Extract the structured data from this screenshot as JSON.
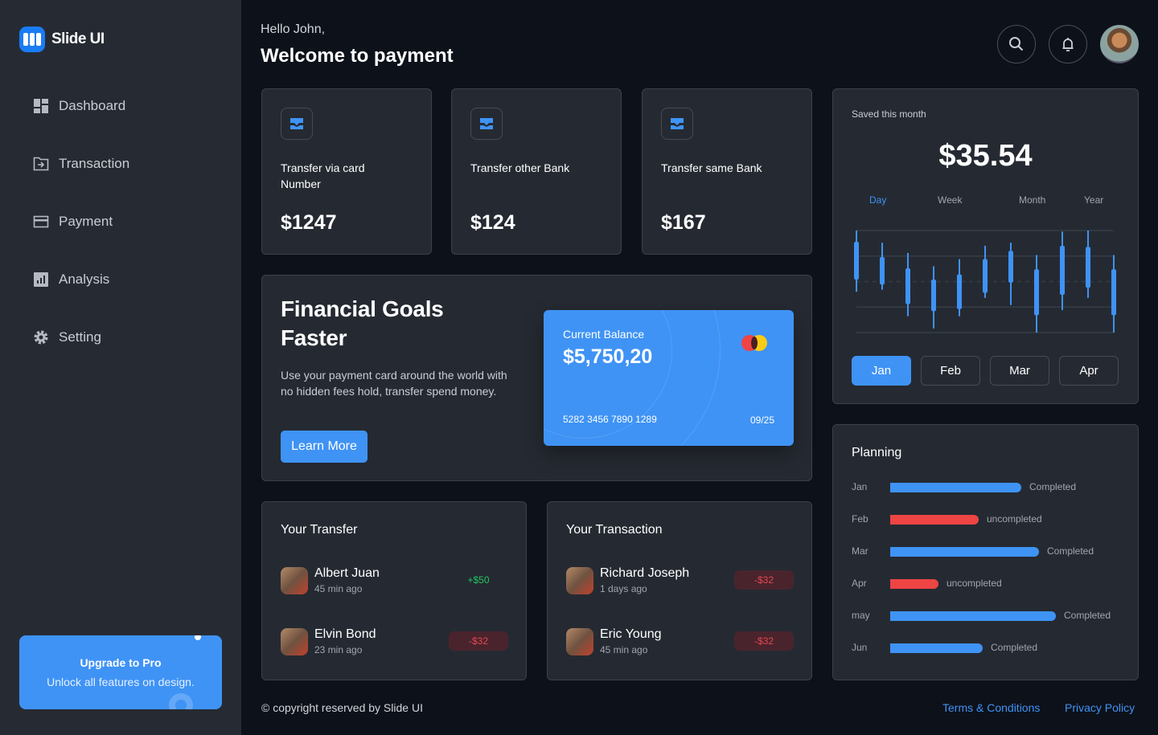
{
  "brand": {
    "name": "Slide UI",
    "accent": "#3f93f5"
  },
  "sidebar": {
    "items": [
      {
        "label": "Dashboard",
        "icon": "dashboard-icon"
      },
      {
        "label": "Transaction",
        "icon": "folder-arrow-icon"
      },
      {
        "label": "Payment",
        "icon": "credit-card-icon"
      },
      {
        "label": "Analysis",
        "icon": "bar-chart-icon"
      },
      {
        "label": "Setting",
        "icon": "gear-icon"
      }
    ],
    "upgrade": {
      "title": "Upgrade to Pro",
      "subtitle": "Unlock all features on design."
    }
  },
  "header": {
    "greeting": "Hello John,",
    "title": "Welcome to payment"
  },
  "transfer_cards": [
    {
      "label": "Transfer via card Number",
      "amount": "$1247"
    },
    {
      "label": "Transfer other Bank",
      "amount": "$124"
    },
    {
      "label": "Transfer same Bank",
      "amount": "$167"
    }
  ],
  "goals": {
    "title": "Financial Goals Faster",
    "description": "Use your payment card around the world with no hidden fees hold, transfer spend money.",
    "button": "Learn More",
    "card": {
      "balance_label": "Current Balance",
      "balance": "$5,750,20",
      "number": "5282 3456 7890 1289",
      "expiry": "09/25"
    }
  },
  "your_transfer": {
    "title": "Your Transfer",
    "items": [
      {
        "name": "Albert Juan",
        "time": "45 min ago",
        "amount": "+$50",
        "type": "positive"
      },
      {
        "name": "Elvin Bond",
        "time": "23 min ago",
        "amount": "-$32",
        "type": "negative"
      }
    ]
  },
  "your_transaction": {
    "title": "Your Transaction",
    "items": [
      {
        "name": "Richard Joseph",
        "time": "1 days ago",
        "amount": "-$32",
        "type": "negative"
      },
      {
        "name": "Eric Young",
        "time": "45 min ago",
        "amount": "-$32",
        "type": "negative"
      }
    ]
  },
  "saved": {
    "label": "Saved this month",
    "amount": "$35.54",
    "periods": [
      "Day",
      "Week",
      "Month",
      "Year"
    ],
    "active_period": "Day",
    "months": [
      "Jan",
      "Feb",
      "Mar",
      "Apr"
    ],
    "active_month": "Jan"
  },
  "chart_data": {
    "type": "candlestick",
    "grid": true,
    "candles": [
      {
        "high": 100,
        "low": 40,
        "body_high": 89,
        "body_low": 52
      },
      {
        "high": 88,
        "low": 42,
        "body_high": 74,
        "body_low": 47
      },
      {
        "high": 78,
        "low": 16,
        "body_high": 63,
        "body_low": 28
      },
      {
        "high": 65,
        "low": 4,
        "body_high": 52,
        "body_low": 21
      },
      {
        "high": 72,
        "low": 16,
        "body_high": 57,
        "body_low": 23
      },
      {
        "high": 85,
        "low": 34,
        "body_high": 72,
        "body_low": 39
      },
      {
        "high": 88,
        "low": 27,
        "body_high": 80,
        "body_low": 49
      },
      {
        "high": 76,
        "low": 0,
        "body_high": 62,
        "body_low": 17
      },
      {
        "high": 99,
        "low": 22,
        "body_high": 85,
        "body_low": 37
      },
      {
        "high": 100,
        "low": 34,
        "body_high": 84,
        "body_low": 44
      },
      {
        "high": 76,
        "low": 0,
        "body_high": 62,
        "body_low": 17
      }
    ],
    "color": "#3f93f5"
  },
  "planning": {
    "title": "Planning",
    "rows": [
      {
        "month": "Jan",
        "progress": 0.68,
        "status": "Completed",
        "color": "#3f93f5"
      },
      {
        "month": "Feb",
        "progress": 0.46,
        "status": "uncompleted",
        "color": "#ef4444"
      },
      {
        "month": "Mar",
        "progress": 0.77,
        "status": "Completed",
        "color": "#3f93f5"
      },
      {
        "month": "Apr",
        "progress": 0.25,
        "status": "uncompleted",
        "color": "#ef4444"
      },
      {
        "month": "may",
        "progress": 0.86,
        "status": "Completed",
        "color": "#3f93f5"
      },
      {
        "month": "Jun",
        "progress": 0.48,
        "status": "Completed",
        "color": "#3f93f5"
      }
    ]
  },
  "footer": {
    "copyright": "© copyright reserved by Slide UI",
    "terms": "Terms & Conditions",
    "privacy": "Privacy Policy"
  }
}
